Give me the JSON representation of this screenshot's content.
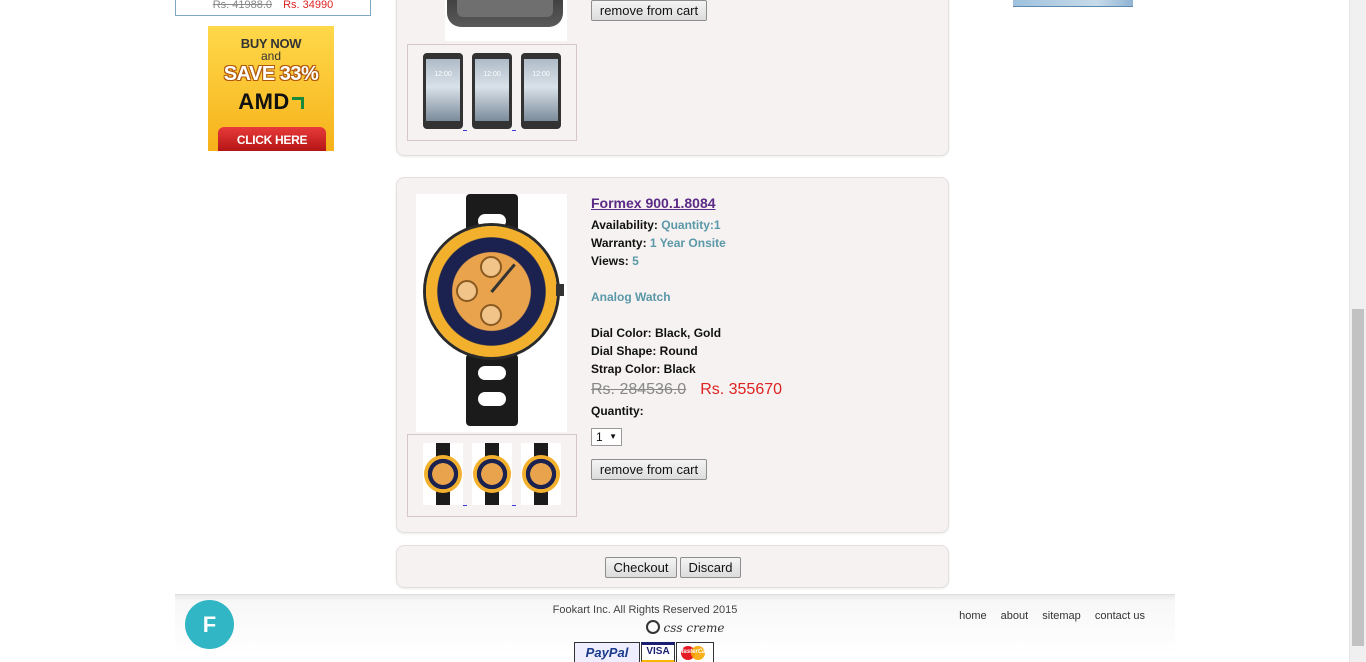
{
  "left": {
    "price_box": {
      "old_price": "Rs. 41988.0",
      "new_price": "Rs. 34990"
    },
    "ad": {
      "buy_now": "BUY NOW",
      "and": "and",
      "save": "SAVE 33%",
      "brand": "AMD",
      "cta": "CLICK HERE"
    }
  },
  "cart": {
    "item1": {
      "remove_label": "remove from cart",
      "thumb_time": "12:00"
    },
    "item2": {
      "title": "Formex 900.1.8084",
      "availability_label": "Availability:",
      "availability_value": "Quantity:1",
      "warranty_label": "Warranty:",
      "warranty_value": "1 Year Onsite",
      "views_label": "Views:",
      "views_value": "5",
      "category": "Analog Watch",
      "dial_color": "Dial Color: Black, Gold",
      "dial_shape": "Dial Shape: Round",
      "strap_color": "Strap Color: Black",
      "old_price": "Rs. 284536.0",
      "new_price": "Rs. 355670",
      "quantity_label": "Quantity:",
      "quantity_value": "1",
      "remove_label": "remove from cart"
    },
    "actions": {
      "checkout_label": "Checkout",
      "discard_label": "Discard"
    }
  },
  "footer": {
    "logo_letter": "F",
    "copyright": "Fookart Inc. All Rights Reserved 2015",
    "credit": "css creme",
    "payments": {
      "paypal": "PayPal",
      "visa": "VISA",
      "mastercard": "MasterCard"
    },
    "nav": [
      "home",
      "about",
      "sitemap",
      "contact us"
    ]
  }
}
